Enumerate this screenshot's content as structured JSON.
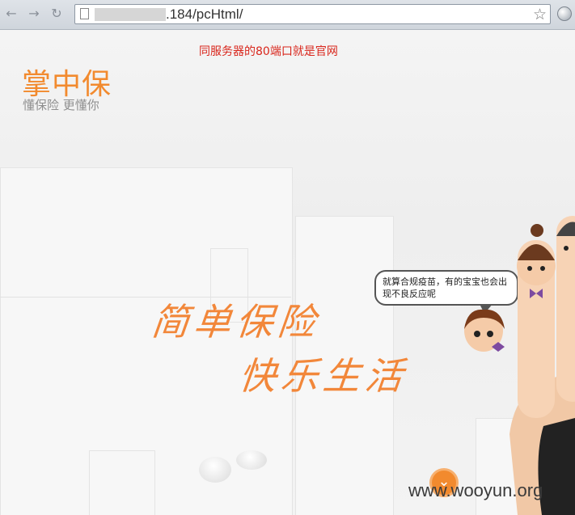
{
  "browser": {
    "back_icon": "back-arrow-icon",
    "forward_icon": "forward-arrow-icon",
    "reload_icon": "reload-icon",
    "url": ".184/pcHtml/",
    "bookmark_icon": "star-icon"
  },
  "page": {
    "notice": "同服务器的80端口就是官网",
    "logo": "掌中保",
    "slogan": "懂保险 更懂你",
    "hero_line1": "简单保险",
    "hero_line2": "快乐生活",
    "bubble_text": "就算合规疫苗，有的宝宝也会出现不良反应呢",
    "scroll_icon": "chevron-down-icon",
    "watermark": "www.wooyun.org"
  },
  "colors": {
    "accent": "#f28a2e",
    "notice": "#d9261c"
  }
}
